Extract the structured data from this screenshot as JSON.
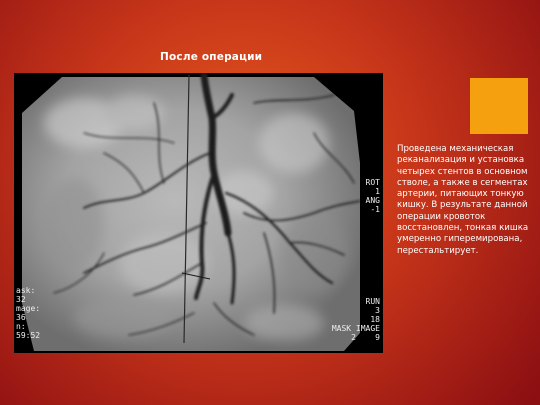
{
  "slide": {
    "title": "После операции",
    "description": "Проведена механическая реканализация и установка четырех стентов в основном стволе, а также в сегментах артерии, питающих тонкую кишку. В результате данной операции кровоток восстановлен, тонкая кишка умеренно гиперемирована, перестальтирует.",
    "accent_color": "#f5a10f",
    "background_color": "#c8361a"
  },
  "angiogram": {
    "right_labels": [
      "ROT",
      "1",
      "ANG",
      "-1"
    ],
    "left_labels": [
      "ask:",
      "32",
      "mage:",
      "36",
      "n:",
      "59:52"
    ],
    "bottom_labels": [
      "RUN",
      "3",
      "18",
      "MASK IMAGE",
      "2    9"
    ]
  }
}
